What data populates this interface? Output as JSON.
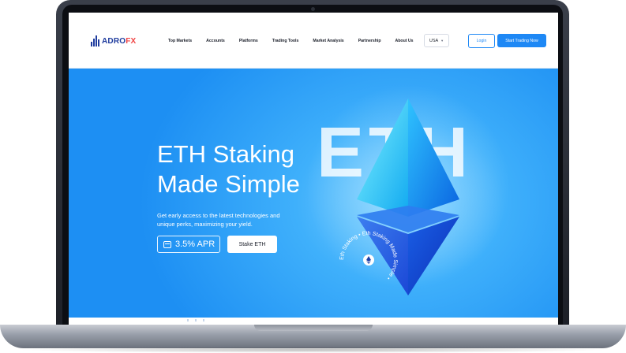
{
  "brand": {
    "name_part1": "ADRO",
    "name_part2": "FX"
  },
  "nav": {
    "items": [
      {
        "label": "Top Markets"
      },
      {
        "label": "Accounts"
      },
      {
        "label": "Platforms"
      },
      {
        "label": "Trading Tools"
      },
      {
        "label": "Market Analysis"
      },
      {
        "label": "Partnership"
      },
      {
        "label": "About Us"
      }
    ]
  },
  "header": {
    "language": "USA",
    "login_label": "Login",
    "start_label": "Start Trading Now"
  },
  "hero": {
    "background_text": "ETH",
    "title_line1": "ETH Staking",
    "title_line2": "Made Simple",
    "subtitle": "Get early access to the latest technologies and unique perks, maximizing your yield.",
    "apr_label": "3.5% APR",
    "stake_label": "Stake ETH",
    "ring_text": "Eth Staking  •  Eth Staking Made Simple  •"
  },
  "colors": {
    "accent": "#1e88f5",
    "brand_blue": "#1f3c9e",
    "brand_red": "#f04444",
    "hero_blue": "#1d8ff3"
  },
  "icons": {
    "apr": "calendar-icon",
    "ring": "ethereum-icon",
    "language": "chevron-down-icon"
  }
}
